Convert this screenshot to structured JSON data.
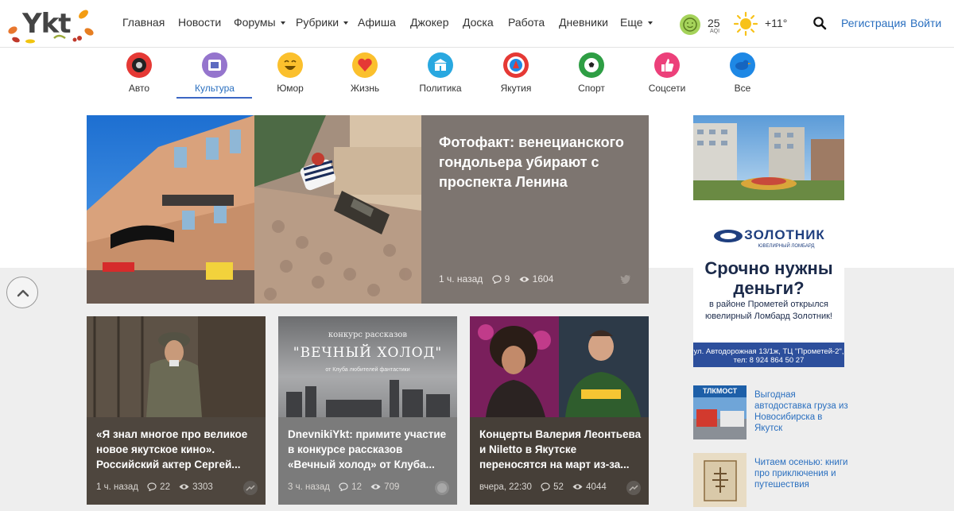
{
  "brand": {
    "logo_text": "Ykt"
  },
  "nav": {
    "items": [
      {
        "label": "Главная"
      },
      {
        "label": "Новости"
      },
      {
        "label": "Форумы",
        "dropdown": true
      },
      {
        "label": "Рубрики",
        "dropdown": true
      },
      {
        "label": "Афиша"
      },
      {
        "label": "Джокер"
      },
      {
        "label": "Доска"
      },
      {
        "label": "Работа"
      },
      {
        "label": "Дневники"
      },
      {
        "label": "Еще",
        "dropdown": true
      }
    ],
    "aqi_value": "25",
    "aqi_label": "AQI",
    "temperature": "+11°",
    "register_label": "Регистрация",
    "login_label": "Войти"
  },
  "categories": [
    {
      "label": "Авто",
      "icon": "car-wheel-icon",
      "color": "#e53935"
    },
    {
      "label": "Культура",
      "icon": "film-icon",
      "color": "#7e57c2",
      "active": true
    },
    {
      "label": "Юмор",
      "icon": "laughing-face-icon",
      "color": "#fbc02d"
    },
    {
      "label": "Жизнь",
      "icon": "heart-icon",
      "color": "#f9a825"
    },
    {
      "label": "Политика",
      "icon": "government-building-icon",
      "color": "#29a8e0"
    },
    {
      "label": "Якутия",
      "icon": "yakutia-emblem-icon",
      "color": "#e53935"
    },
    {
      "label": "Спорт",
      "icon": "soccer-ball-icon",
      "color": "#2e9e44"
    },
    {
      "label": "Соцсети",
      "icon": "thumbs-up-icon",
      "color": "#ec407a"
    },
    {
      "label": "Все",
      "icon": "bird-icon",
      "color": "#1e88e5"
    }
  ],
  "hero": {
    "title": "Фотофакт: венецианского гондольера убирают с проспекта Ленина",
    "time": "1 ч. назад",
    "comments": "9",
    "views": "1604"
  },
  "cards": [
    {
      "title": "«Я знал многое про великое новое якутское кино». Российский актер Сергей...",
      "time": "1 ч. назад",
      "comments": "22",
      "views": "3303",
      "color": "#4e463e"
    },
    {
      "title": "DnevnikiYkt: примите участие в конкурсе рассказов «Вечный холод» от Клуба...",
      "time": "3 ч. назад",
      "comments": "12",
      "views": "709",
      "color": "#7b7b7b",
      "image_caption_top": "конкурс рассказов",
      "image_caption_title": "\"ВЕЧНЫЙ ХОЛОД\"",
      "image_caption_sub": "от Клуба любителей фантастики"
    },
    {
      "title": "Концерты Валерия Леонтьева и Niletto в Якутске переносятся на март из-за...",
      "time": "вчера, 22:30",
      "comments": "52",
      "views": "4044",
      "color": "#463f38"
    }
  ],
  "ad": {
    "brand": "ЗОЛОТНИК",
    "brand_sub": "ЮВЕЛИРНЫЙ ЛОМБАРД",
    "headline": "Срочно нужны деньги?",
    "text": "в районе Прометей открылся ювелирный Ломбард Золотник!",
    "footer": "ул. Автодорожная 13/1ж, ТЦ \"Прометей-2\", тел: 8 924 864 50 27"
  },
  "side_news": [
    {
      "title": "Выгодная автодоставка груза из Новосибирска в Якутск",
      "thumb_label": "ТЛКМОСТ"
    },
    {
      "title": "Читаем осенью: книги про приключения и путешествия"
    }
  ]
}
